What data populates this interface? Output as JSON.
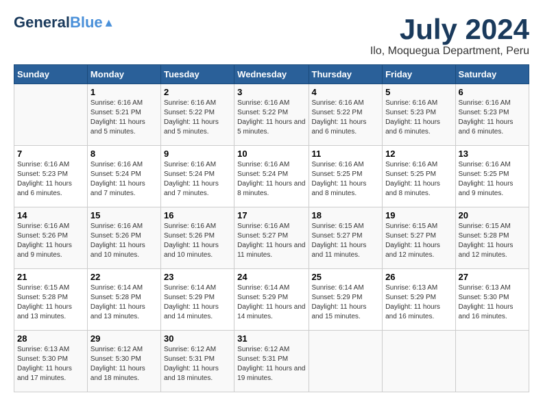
{
  "header": {
    "logo_general": "General",
    "logo_blue": "Blue",
    "month_title": "July 2024",
    "location": "Ilo, Moquegua Department, Peru"
  },
  "calendar": {
    "weekdays": [
      "Sunday",
      "Monday",
      "Tuesday",
      "Wednesday",
      "Thursday",
      "Friday",
      "Saturday"
    ],
    "weeks": [
      [
        {
          "day": "",
          "sunrise": "",
          "sunset": "",
          "daylight": "",
          "empty": true
        },
        {
          "day": "1",
          "sunrise": "Sunrise: 6:16 AM",
          "sunset": "Sunset: 5:21 PM",
          "daylight": "Daylight: 11 hours and 5 minutes."
        },
        {
          "day": "2",
          "sunrise": "Sunrise: 6:16 AM",
          "sunset": "Sunset: 5:22 PM",
          "daylight": "Daylight: 11 hours and 5 minutes."
        },
        {
          "day": "3",
          "sunrise": "Sunrise: 6:16 AM",
          "sunset": "Sunset: 5:22 PM",
          "daylight": "Daylight: 11 hours and 5 minutes."
        },
        {
          "day": "4",
          "sunrise": "Sunrise: 6:16 AM",
          "sunset": "Sunset: 5:22 PM",
          "daylight": "Daylight: 11 hours and 6 minutes."
        },
        {
          "day": "5",
          "sunrise": "Sunrise: 6:16 AM",
          "sunset": "Sunset: 5:23 PM",
          "daylight": "Daylight: 11 hours and 6 minutes."
        },
        {
          "day": "6",
          "sunrise": "Sunrise: 6:16 AM",
          "sunset": "Sunset: 5:23 PM",
          "daylight": "Daylight: 11 hours and 6 minutes."
        }
      ],
      [
        {
          "day": "7",
          "sunrise": "Sunrise: 6:16 AM",
          "sunset": "Sunset: 5:23 PM",
          "daylight": "Daylight: 11 hours and 6 minutes."
        },
        {
          "day": "8",
          "sunrise": "Sunrise: 6:16 AM",
          "sunset": "Sunset: 5:24 PM",
          "daylight": "Daylight: 11 hours and 7 minutes."
        },
        {
          "day": "9",
          "sunrise": "Sunrise: 6:16 AM",
          "sunset": "Sunset: 5:24 PM",
          "daylight": "Daylight: 11 hours and 7 minutes."
        },
        {
          "day": "10",
          "sunrise": "Sunrise: 6:16 AM",
          "sunset": "Sunset: 5:24 PM",
          "daylight": "Daylight: 11 hours and 8 minutes."
        },
        {
          "day": "11",
          "sunrise": "Sunrise: 6:16 AM",
          "sunset": "Sunset: 5:25 PM",
          "daylight": "Daylight: 11 hours and 8 minutes."
        },
        {
          "day": "12",
          "sunrise": "Sunrise: 6:16 AM",
          "sunset": "Sunset: 5:25 PM",
          "daylight": "Daylight: 11 hours and 8 minutes."
        },
        {
          "day": "13",
          "sunrise": "Sunrise: 6:16 AM",
          "sunset": "Sunset: 5:25 PM",
          "daylight": "Daylight: 11 hours and 9 minutes."
        }
      ],
      [
        {
          "day": "14",
          "sunrise": "Sunrise: 6:16 AM",
          "sunset": "Sunset: 5:26 PM",
          "daylight": "Daylight: 11 hours and 9 minutes."
        },
        {
          "day": "15",
          "sunrise": "Sunrise: 6:16 AM",
          "sunset": "Sunset: 5:26 PM",
          "daylight": "Daylight: 11 hours and 10 minutes."
        },
        {
          "day": "16",
          "sunrise": "Sunrise: 6:16 AM",
          "sunset": "Sunset: 5:26 PM",
          "daylight": "Daylight: 11 hours and 10 minutes."
        },
        {
          "day": "17",
          "sunrise": "Sunrise: 6:16 AM",
          "sunset": "Sunset: 5:27 PM",
          "daylight": "Daylight: 11 hours and 11 minutes."
        },
        {
          "day": "18",
          "sunrise": "Sunrise: 6:15 AM",
          "sunset": "Sunset: 5:27 PM",
          "daylight": "Daylight: 11 hours and 11 minutes."
        },
        {
          "day": "19",
          "sunrise": "Sunrise: 6:15 AM",
          "sunset": "Sunset: 5:27 PM",
          "daylight": "Daylight: 11 hours and 12 minutes."
        },
        {
          "day": "20",
          "sunrise": "Sunrise: 6:15 AM",
          "sunset": "Sunset: 5:28 PM",
          "daylight": "Daylight: 11 hours and 12 minutes."
        }
      ],
      [
        {
          "day": "21",
          "sunrise": "Sunrise: 6:15 AM",
          "sunset": "Sunset: 5:28 PM",
          "daylight": "Daylight: 11 hours and 13 minutes."
        },
        {
          "day": "22",
          "sunrise": "Sunrise: 6:14 AM",
          "sunset": "Sunset: 5:28 PM",
          "daylight": "Daylight: 11 hours and 13 minutes."
        },
        {
          "day": "23",
          "sunrise": "Sunrise: 6:14 AM",
          "sunset": "Sunset: 5:29 PM",
          "daylight": "Daylight: 11 hours and 14 minutes."
        },
        {
          "day": "24",
          "sunrise": "Sunrise: 6:14 AM",
          "sunset": "Sunset: 5:29 PM",
          "daylight": "Daylight: 11 hours and 14 minutes."
        },
        {
          "day": "25",
          "sunrise": "Sunrise: 6:14 AM",
          "sunset": "Sunset: 5:29 PM",
          "daylight": "Daylight: 11 hours and 15 minutes."
        },
        {
          "day": "26",
          "sunrise": "Sunrise: 6:13 AM",
          "sunset": "Sunset: 5:29 PM",
          "daylight": "Daylight: 11 hours and 16 minutes."
        },
        {
          "day": "27",
          "sunrise": "Sunrise: 6:13 AM",
          "sunset": "Sunset: 5:30 PM",
          "daylight": "Daylight: 11 hours and 16 minutes."
        }
      ],
      [
        {
          "day": "28",
          "sunrise": "Sunrise: 6:13 AM",
          "sunset": "Sunset: 5:30 PM",
          "daylight": "Daylight: 11 hours and 17 minutes."
        },
        {
          "day": "29",
          "sunrise": "Sunrise: 6:12 AM",
          "sunset": "Sunset: 5:30 PM",
          "daylight": "Daylight: 11 hours and 18 minutes."
        },
        {
          "day": "30",
          "sunrise": "Sunrise: 6:12 AM",
          "sunset": "Sunset: 5:31 PM",
          "daylight": "Daylight: 11 hours and 18 minutes."
        },
        {
          "day": "31",
          "sunrise": "Sunrise: 6:12 AM",
          "sunset": "Sunset: 5:31 PM",
          "daylight": "Daylight: 11 hours and 19 minutes."
        },
        {
          "day": "",
          "sunrise": "",
          "sunset": "",
          "daylight": "",
          "empty": true
        },
        {
          "day": "",
          "sunrise": "",
          "sunset": "",
          "daylight": "",
          "empty": true
        },
        {
          "day": "",
          "sunrise": "",
          "sunset": "",
          "daylight": "",
          "empty": true
        }
      ]
    ]
  }
}
